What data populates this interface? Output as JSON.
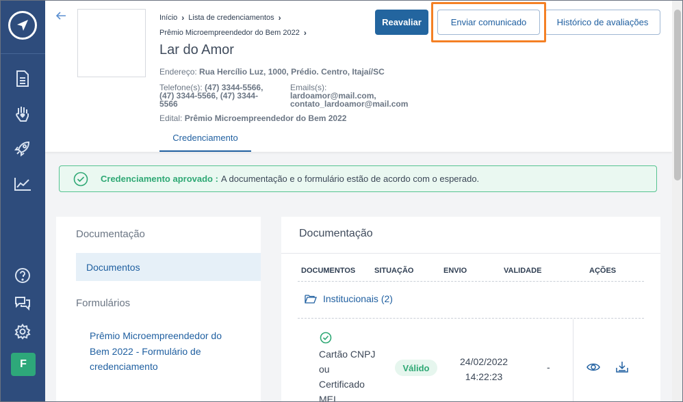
{
  "sidebar": {
    "avatar_letter": "F",
    "icons": [
      "logo-icon",
      "document-icon",
      "hand-heart-icon",
      "rocket-icon",
      "chart-icon",
      "help-icon",
      "chat-icon",
      "gear-icon"
    ]
  },
  "breadcrumb": {
    "items": [
      "Início",
      "Lista de credenciamentos",
      "Prêmio Microempreendedor do Bem 2022"
    ]
  },
  "header": {
    "title": "Lar do Amor",
    "address_label": "Endereço:",
    "address_value": "Rua Hercílio Luz, 1000, Prédio. Centro, Itajaí/SC",
    "phone_label": "Telefone(s):",
    "phone_line1": "(47) 3344-5566,",
    "phone_line2": "(47) 3344-5566, (47) 3344-",
    "phone_line3": "5566",
    "email_label": "Emails(s):",
    "email_line1": "lardoamor@mail.com,",
    "email_line2": "contato_lardoamor@mail.com",
    "edital_label": "Edital:",
    "edital_value": "Prêmio Microempreendedor do Bem 2022",
    "tab": "Credenciamento"
  },
  "buttons": {
    "reavaliar": "Reavaliar",
    "enviar": "Enviar comunicado",
    "historico": "Histórico de avaliações"
  },
  "alert": {
    "title": "Credenciamento aprovado :",
    "message": "A documentação e o formulário estão de acordo com o esperado."
  },
  "left_panel": {
    "doc_heading": "Documentação",
    "doc_item": "Documentos",
    "form_heading": "Formulários",
    "form_link_line1": "Prêmio Microempreendedor do",
    "form_link_line2": "Bem 2022 - Formulário de",
    "form_link_line3": "credenciamento"
  },
  "right_panel": {
    "title": "Documentação",
    "columns": [
      "DOCUMENTOS",
      "SITUAÇÃO",
      "ENVIO",
      "VALIDADE",
      "AÇÕES"
    ],
    "folder": "Institucionais (2)",
    "row": {
      "doc_lines": [
        "Cartão CNPJ",
        "ou",
        "Certificado",
        "MEI"
      ],
      "status": "Válido",
      "sent_date": "24/02/2022",
      "sent_time": "14:22:23",
      "validity": "-"
    }
  },
  "colors": {
    "sidebar": "#2e4c7c",
    "primary": "#23659f",
    "success": "#2ea874",
    "highlight": "#f48024"
  }
}
